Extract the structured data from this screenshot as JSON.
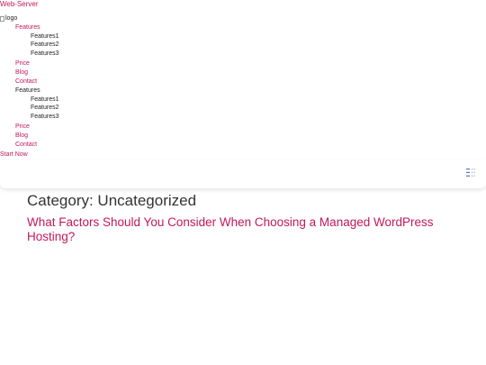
{
  "site": {
    "title": "Web-Server",
    "logo_alt": "logo"
  },
  "menu": [
    {
      "label": "Features",
      "color": "pink",
      "level": 0
    },
    {
      "label": "Features1",
      "color": "dark",
      "level": 1
    },
    {
      "label": "Features2",
      "color": "dark",
      "level": 1
    },
    {
      "label": "Features3",
      "color": "dark",
      "level": 1
    },
    {
      "label": "Price",
      "color": "pink",
      "level": 0
    },
    {
      "label": "Blog",
      "color": "pink",
      "level": 0
    },
    {
      "label": "Contact",
      "color": "pink",
      "level": 0
    },
    {
      "label": "Features",
      "color": "dark",
      "level": 0
    },
    {
      "label": "Features1",
      "color": "dark",
      "level": 1
    },
    {
      "label": "Features2",
      "color": "dark",
      "level": 1
    },
    {
      "label": "Features3",
      "color": "dark",
      "level": 1
    },
    {
      "label": "Price",
      "color": "pink",
      "level": 0
    },
    {
      "label": "Blog",
      "color": "pink",
      "level": 0
    },
    {
      "label": "Contact",
      "color": "pink",
      "level": 0
    }
  ],
  "cta": {
    "label": "Start Now"
  },
  "header": {
    "toggle_icon": "menu-toggle-icon"
  },
  "archive": {
    "title": "Category: Uncategorized",
    "posts": [
      {
        "title": "What Factors Should You Consider When Choosing a Managed WordPress Hosting?"
      }
    ]
  },
  "colors": {
    "accent": "#c2185b",
    "text": "#333333",
    "toggle": "#5c6bc0"
  }
}
